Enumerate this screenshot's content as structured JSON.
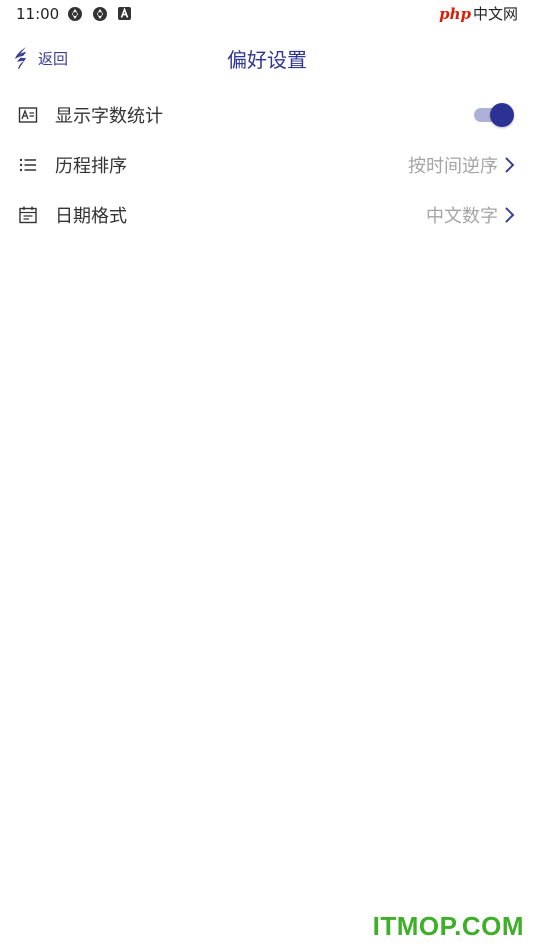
{
  "status_bar": {
    "time": "11:00",
    "watermark_php": "php",
    "watermark_cn": "中文网"
  },
  "header": {
    "back_label": "返回",
    "title": "偏好设置"
  },
  "settings": {
    "word_count": {
      "label": "显示字数统计",
      "enabled": true
    },
    "history_order": {
      "label": "历程排序",
      "value": "按时间逆序"
    },
    "date_format": {
      "label": "日期格式",
      "value": "中文数字"
    }
  },
  "footer": {
    "watermark": "ITMOP.COM"
  },
  "colors": {
    "accent": "#2f3590",
    "toggle_track": "#aeb1d7",
    "value_text": "#a5a5a5",
    "watermark": "#3fae29"
  },
  "icons": {
    "status": [
      "sync-icon",
      "sync-icon",
      "app-a-icon"
    ],
    "word_count": "text-box-icon",
    "history_order": "list-icon",
    "date_format": "calendar-icon",
    "back": "quill-back-icon",
    "chevron": "chevron-right-icon"
  }
}
